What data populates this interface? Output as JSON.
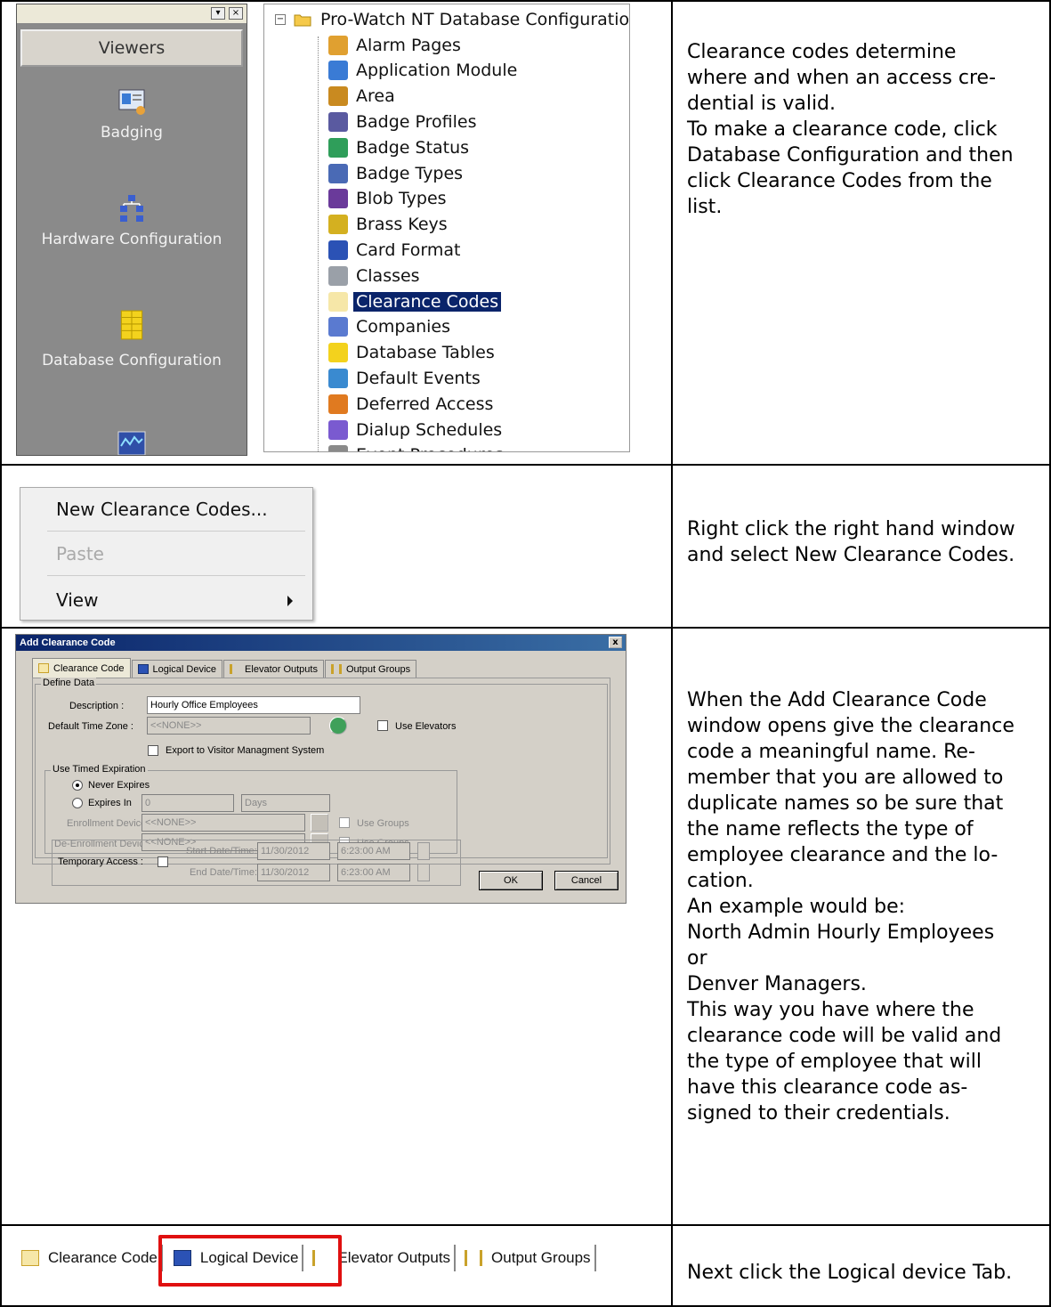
{
  "rows": [
    {
      "text": [
        "Clearance codes determine",
        "where and when an access cre-",
        "dential is valid.",
        "To make a clearance code, click",
        "Database Configuration and then",
        "click Clearance Codes from the",
        "list."
      ]
    },
    {
      "text": [
        "Right click the right hand window",
        "and select New Clearance Codes."
      ]
    },
    {
      "text": [
        "When the Add Clearance Code",
        "window opens give the clearance",
        "code a meaningful name. Re-",
        "member that you are allowed to",
        "duplicate names so be sure that",
        "the name reflects the type of",
        "employee clearance and the lo-",
        "cation.",
        "An example would be:",
        "North Admin Hourly Employees",
        "or",
        "Denver Managers.",
        "This way you have where the",
        "clearance code will be valid and",
        "the type of employee that will",
        "have this clearance code as-",
        "signed to their credentials."
      ]
    },
    {
      "text": [
        "Next click the Logical device Tab."
      ]
    }
  ],
  "viewers": {
    "header": "Viewers",
    "items": [
      "Badging",
      "Hardware Configuration",
      "Database Configuration"
    ]
  },
  "tree": {
    "root": "Pro-Watch NT Database Configuratio",
    "items": [
      {
        "label": "Alarm Pages",
        "icon": "alarm-pages-icon"
      },
      {
        "label": "Application Module",
        "icon": "application-module-icon"
      },
      {
        "label": "Area",
        "icon": "area-icon"
      },
      {
        "label": "Badge Profiles",
        "icon": "badge-profiles-icon"
      },
      {
        "label": "Badge Status",
        "icon": "badge-status-icon"
      },
      {
        "label": "Badge Types",
        "icon": "badge-types-icon"
      },
      {
        "label": "Blob Types",
        "icon": "blob-types-icon"
      },
      {
        "label": "Brass Keys",
        "icon": "brass-keys-icon"
      },
      {
        "label": "Card Format",
        "icon": "card-format-icon"
      },
      {
        "label": "Classes",
        "icon": "classes-icon"
      },
      {
        "label": "Clearance Codes",
        "icon": "clearance-codes-icon",
        "selected": true
      },
      {
        "label": "Companies",
        "icon": "companies-icon"
      },
      {
        "label": "Database Tables",
        "icon": "database-tables-icon"
      },
      {
        "label": "Default Events",
        "icon": "default-events-icon"
      },
      {
        "label": "Deferred Access",
        "icon": "deferred-access-icon"
      },
      {
        "label": "Dialup Schedules",
        "icon": "dialup-schedules-icon"
      },
      {
        "label": "Event Procedures",
        "icon": "event-procedures-icon"
      }
    ]
  },
  "context_menu": {
    "items": [
      {
        "label": "New Clearance Codes...",
        "enabled": true
      },
      {
        "label": "Paste",
        "enabled": false
      },
      {
        "label": "View",
        "enabled": true,
        "submenu": true
      }
    ]
  },
  "dialog": {
    "title": "Add Clearance Code",
    "close": "x",
    "tabs": [
      "Clearance Code",
      "Logical Device",
      "Elevator Outputs",
      "Output Groups"
    ],
    "active_tab": "Clearance Code",
    "define_data": {
      "group_title": "Define Data",
      "description_label": "Description :",
      "description_value": "Hourly Office Employees",
      "timezone_label": "Default Time Zone :",
      "timezone_value": "<<NONE>>",
      "use_elevators": "Use Elevators",
      "export_label": "Export to Visitor Managment System"
    },
    "timed_expiration": {
      "group_title": "Use Timed Expiration",
      "never_expires": "Never Expires",
      "expires_in": "Expires In",
      "expires_value": "0",
      "expires_unit": "Days",
      "enrollment_label": "Enrollment Device :",
      "enrollment_value": "<<NONE>>",
      "deenrollment_label": "De-Enrollment Device :",
      "deenrollment_value": "<<NONE>>",
      "use_groups": "Use Groups"
    },
    "temporary": {
      "label": "Temporary Access :",
      "start_label": "Start Date/Time:",
      "end_label": "End Date/Time:",
      "date": "11/30/2012",
      "time": "6:23:00 AM"
    },
    "ok": "OK",
    "cancel": "Cancel"
  },
  "tabstrip": {
    "tabs": [
      "Clearance Code",
      "Logical Device",
      "Elevator Outputs",
      "Output Groups"
    ],
    "highlighted": "Logical Device"
  },
  "colors": {
    "highlight_box": "#e01010",
    "selection": "#0a246a",
    "viewer_bg": "#8a8a8a"
  }
}
